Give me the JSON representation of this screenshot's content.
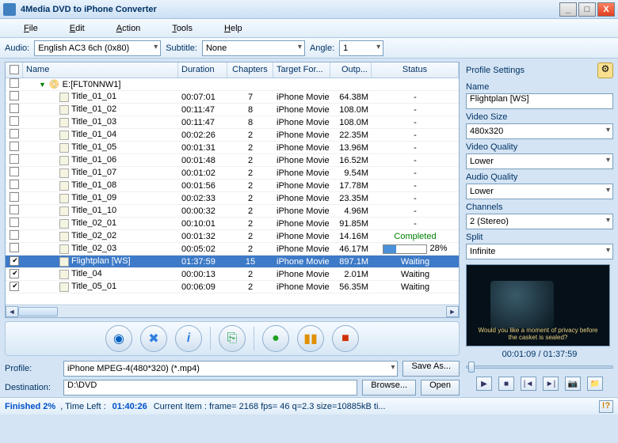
{
  "window": {
    "title": "4Media DVD to iPhone Converter"
  },
  "menu": [
    "File",
    "Edit",
    "Action",
    "Tools",
    "Help"
  ],
  "toolbar": {
    "audio_label": "Audio:",
    "audio_value": "English AC3 6ch (0x80)",
    "subtitle_label": "Subtitle:",
    "subtitle_value": "None",
    "angle_label": "Angle:",
    "angle_value": "1"
  },
  "columns": {
    "name": "Name",
    "duration": "Duration",
    "chapters": "Chapters",
    "target": "Target For...",
    "output": "Outp...",
    "status": "Status"
  },
  "disc_label": "E:[FLT0NNW1]",
  "rows": [
    {
      "chk": false,
      "name": "Title_01_01",
      "dur": "00:07:01",
      "chap": "7",
      "fmt": "iPhone Movie",
      "out": "64.38M",
      "stat": "-"
    },
    {
      "chk": false,
      "name": "Title_01_02",
      "dur": "00:11:47",
      "chap": "8",
      "fmt": "iPhone Movie",
      "out": "108.0M",
      "stat": "-"
    },
    {
      "chk": false,
      "name": "Title_01_03",
      "dur": "00:11:47",
      "chap": "8",
      "fmt": "iPhone Movie",
      "out": "108.0M",
      "stat": "-"
    },
    {
      "chk": false,
      "name": "Title_01_04",
      "dur": "00:02:26",
      "chap": "2",
      "fmt": "iPhone Movie",
      "out": "22.35M",
      "stat": "-"
    },
    {
      "chk": false,
      "name": "Title_01_05",
      "dur": "00:01:31",
      "chap": "2",
      "fmt": "iPhone Movie",
      "out": "13.96M",
      "stat": "-"
    },
    {
      "chk": false,
      "name": "Title_01_06",
      "dur": "00:01:48",
      "chap": "2",
      "fmt": "iPhone Movie",
      "out": "16.52M",
      "stat": "-"
    },
    {
      "chk": false,
      "name": "Title_01_07",
      "dur": "00:01:02",
      "chap": "2",
      "fmt": "iPhone Movie",
      "out": "9.54M",
      "stat": "-"
    },
    {
      "chk": false,
      "name": "Title_01_08",
      "dur": "00:01:56",
      "chap": "2",
      "fmt": "iPhone Movie",
      "out": "17.78M",
      "stat": "-"
    },
    {
      "chk": false,
      "name": "Title_01_09",
      "dur": "00:02:33",
      "chap": "2",
      "fmt": "iPhone Movie",
      "out": "23.35M",
      "stat": "-"
    },
    {
      "chk": false,
      "name": "Title_01_10",
      "dur": "00:00:32",
      "chap": "2",
      "fmt": "iPhone Movie",
      "out": "4.96M",
      "stat": "-"
    },
    {
      "chk": false,
      "name": "Title_02_01",
      "dur": "00:10:01",
      "chap": "2",
      "fmt": "iPhone Movie",
      "out": "91.85M",
      "stat": "-"
    },
    {
      "chk": false,
      "name": "Title_02_02",
      "dur": "00:01:32",
      "chap": "2",
      "fmt": "iPhone Movie",
      "out": "14.16M",
      "stat": "Completed"
    },
    {
      "chk": false,
      "name": "Title_02_03",
      "dur": "00:05:02",
      "chap": "2",
      "fmt": "iPhone Movie",
      "out": "46.17M",
      "stat": "28%",
      "progress": 28
    },
    {
      "chk": true,
      "sel": true,
      "name": "Flightplan [WS]",
      "dur": "01:37:59",
      "chap": "15",
      "fmt": "iPhone Movie",
      "out": "897.1M",
      "stat": "Waiting"
    },
    {
      "chk": true,
      "name": "Title_04",
      "dur": "00:00:13",
      "chap": "2",
      "fmt": "iPhone Movie",
      "out": "2.01M",
      "stat": "Waiting"
    },
    {
      "chk": true,
      "name": "Title_05_01",
      "dur": "00:06:09",
      "chap": "2",
      "fmt": "iPhone Movie",
      "out": "56.35M",
      "stat": "Waiting"
    }
  ],
  "bottom": {
    "profile_label": "Profile:",
    "profile_value": "iPhone MPEG-4(480*320) (*.mp4)",
    "save_as": "Save As...",
    "dest_label": "Destination:",
    "dest_value": "D:\\DVD",
    "browse": "Browse...",
    "open": "Open"
  },
  "status": {
    "finished": "Finished 2%",
    "timeleft_label": ", Time Left :",
    "timeleft": "01:40:26",
    "current": "Current Item : frame= 2168 fps= 46 q=2.3 size=10885kB ti..."
  },
  "profile_settings": {
    "header": "Profile Settings",
    "name_label": "Name",
    "name_value": "Flightplan [WS]",
    "vsize_label": "Video Size",
    "vsize_value": "480x320",
    "vqual_label": "Video Quality",
    "vqual_value": "Lower",
    "aqual_label": "Audio Quality",
    "aqual_value": "Lower",
    "chan_label": "Channels",
    "chan_value": "2 (Stereo)",
    "split_label": "Split",
    "split_value": "Infinite"
  },
  "preview": {
    "subtitle": "Would you like a moment of privacy before the casket is sealed?",
    "time": "00:01:09 / 01:37:59"
  }
}
